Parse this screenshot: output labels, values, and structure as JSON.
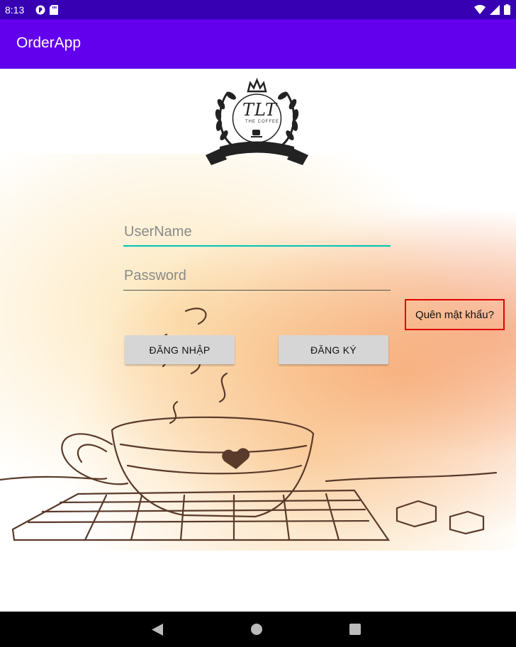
{
  "status_bar": {
    "time": "8:13",
    "left_icons": [
      "media-icon",
      "sd-card-icon"
    ],
    "right_icons": [
      "wifi-icon",
      "signal-icon",
      "battery-icon"
    ]
  },
  "app_bar": {
    "title": "OrderApp"
  },
  "logo": {
    "text": "TLT",
    "subtext": "THE COFFEE"
  },
  "form": {
    "username_placeholder": "UserName",
    "username_value": "",
    "password_placeholder": "Password",
    "password_value": "",
    "forgot_label": "Quên mật khẩu?",
    "login_label": "ĐĂNG NHẬP",
    "register_label": "ĐĂNG KÝ"
  },
  "colors": {
    "status_bar": "#3700b3",
    "app_bar": "#6200ee",
    "focus_underline": "#00c4b4",
    "highlight_border": "#e00000",
    "button": "#d6d6d6"
  },
  "nav_bar": {
    "icons": [
      "back-icon",
      "home-icon",
      "recents-icon"
    ]
  }
}
